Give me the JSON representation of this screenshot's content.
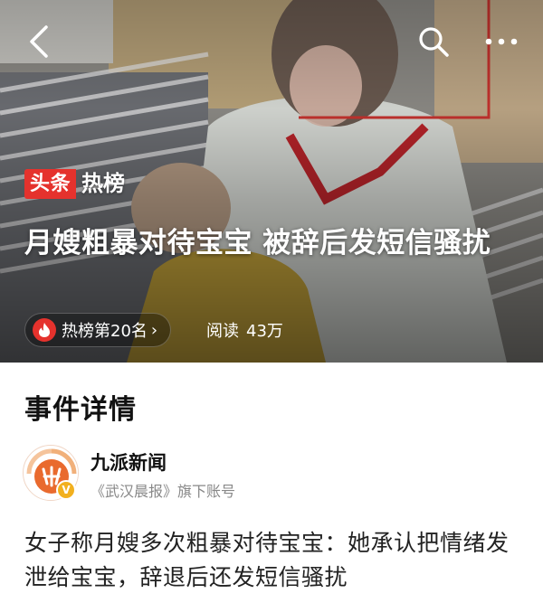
{
  "nav": {
    "back_icon": "chevron-left-icon",
    "search_icon": "search-icon",
    "more_icon": "more-horizontal-icon"
  },
  "hero": {
    "tag_red": "头条",
    "tag_white": "热榜",
    "title": "月嫂粗暴对待宝宝 被辞后发短信骚扰",
    "rank_label": "热榜第20名",
    "rank_chevron": "›",
    "reads_label": "阅读",
    "reads_value": "43万"
  },
  "section": {
    "title": "事件详情"
  },
  "author": {
    "name": "九派新闻",
    "subtitle": "《武汉晨报》旗下账号",
    "verified_badge": "V"
  },
  "article": {
    "text": "女子称月嫂多次粗暴对待宝宝：她承认把情绪发泄给宝宝，辞退后还发短信骚扰"
  },
  "colors": {
    "accent_red": "#e5322d",
    "verify_gold": "#f2b01e",
    "text_dark": "#111111",
    "text_muted": "#888888"
  }
}
